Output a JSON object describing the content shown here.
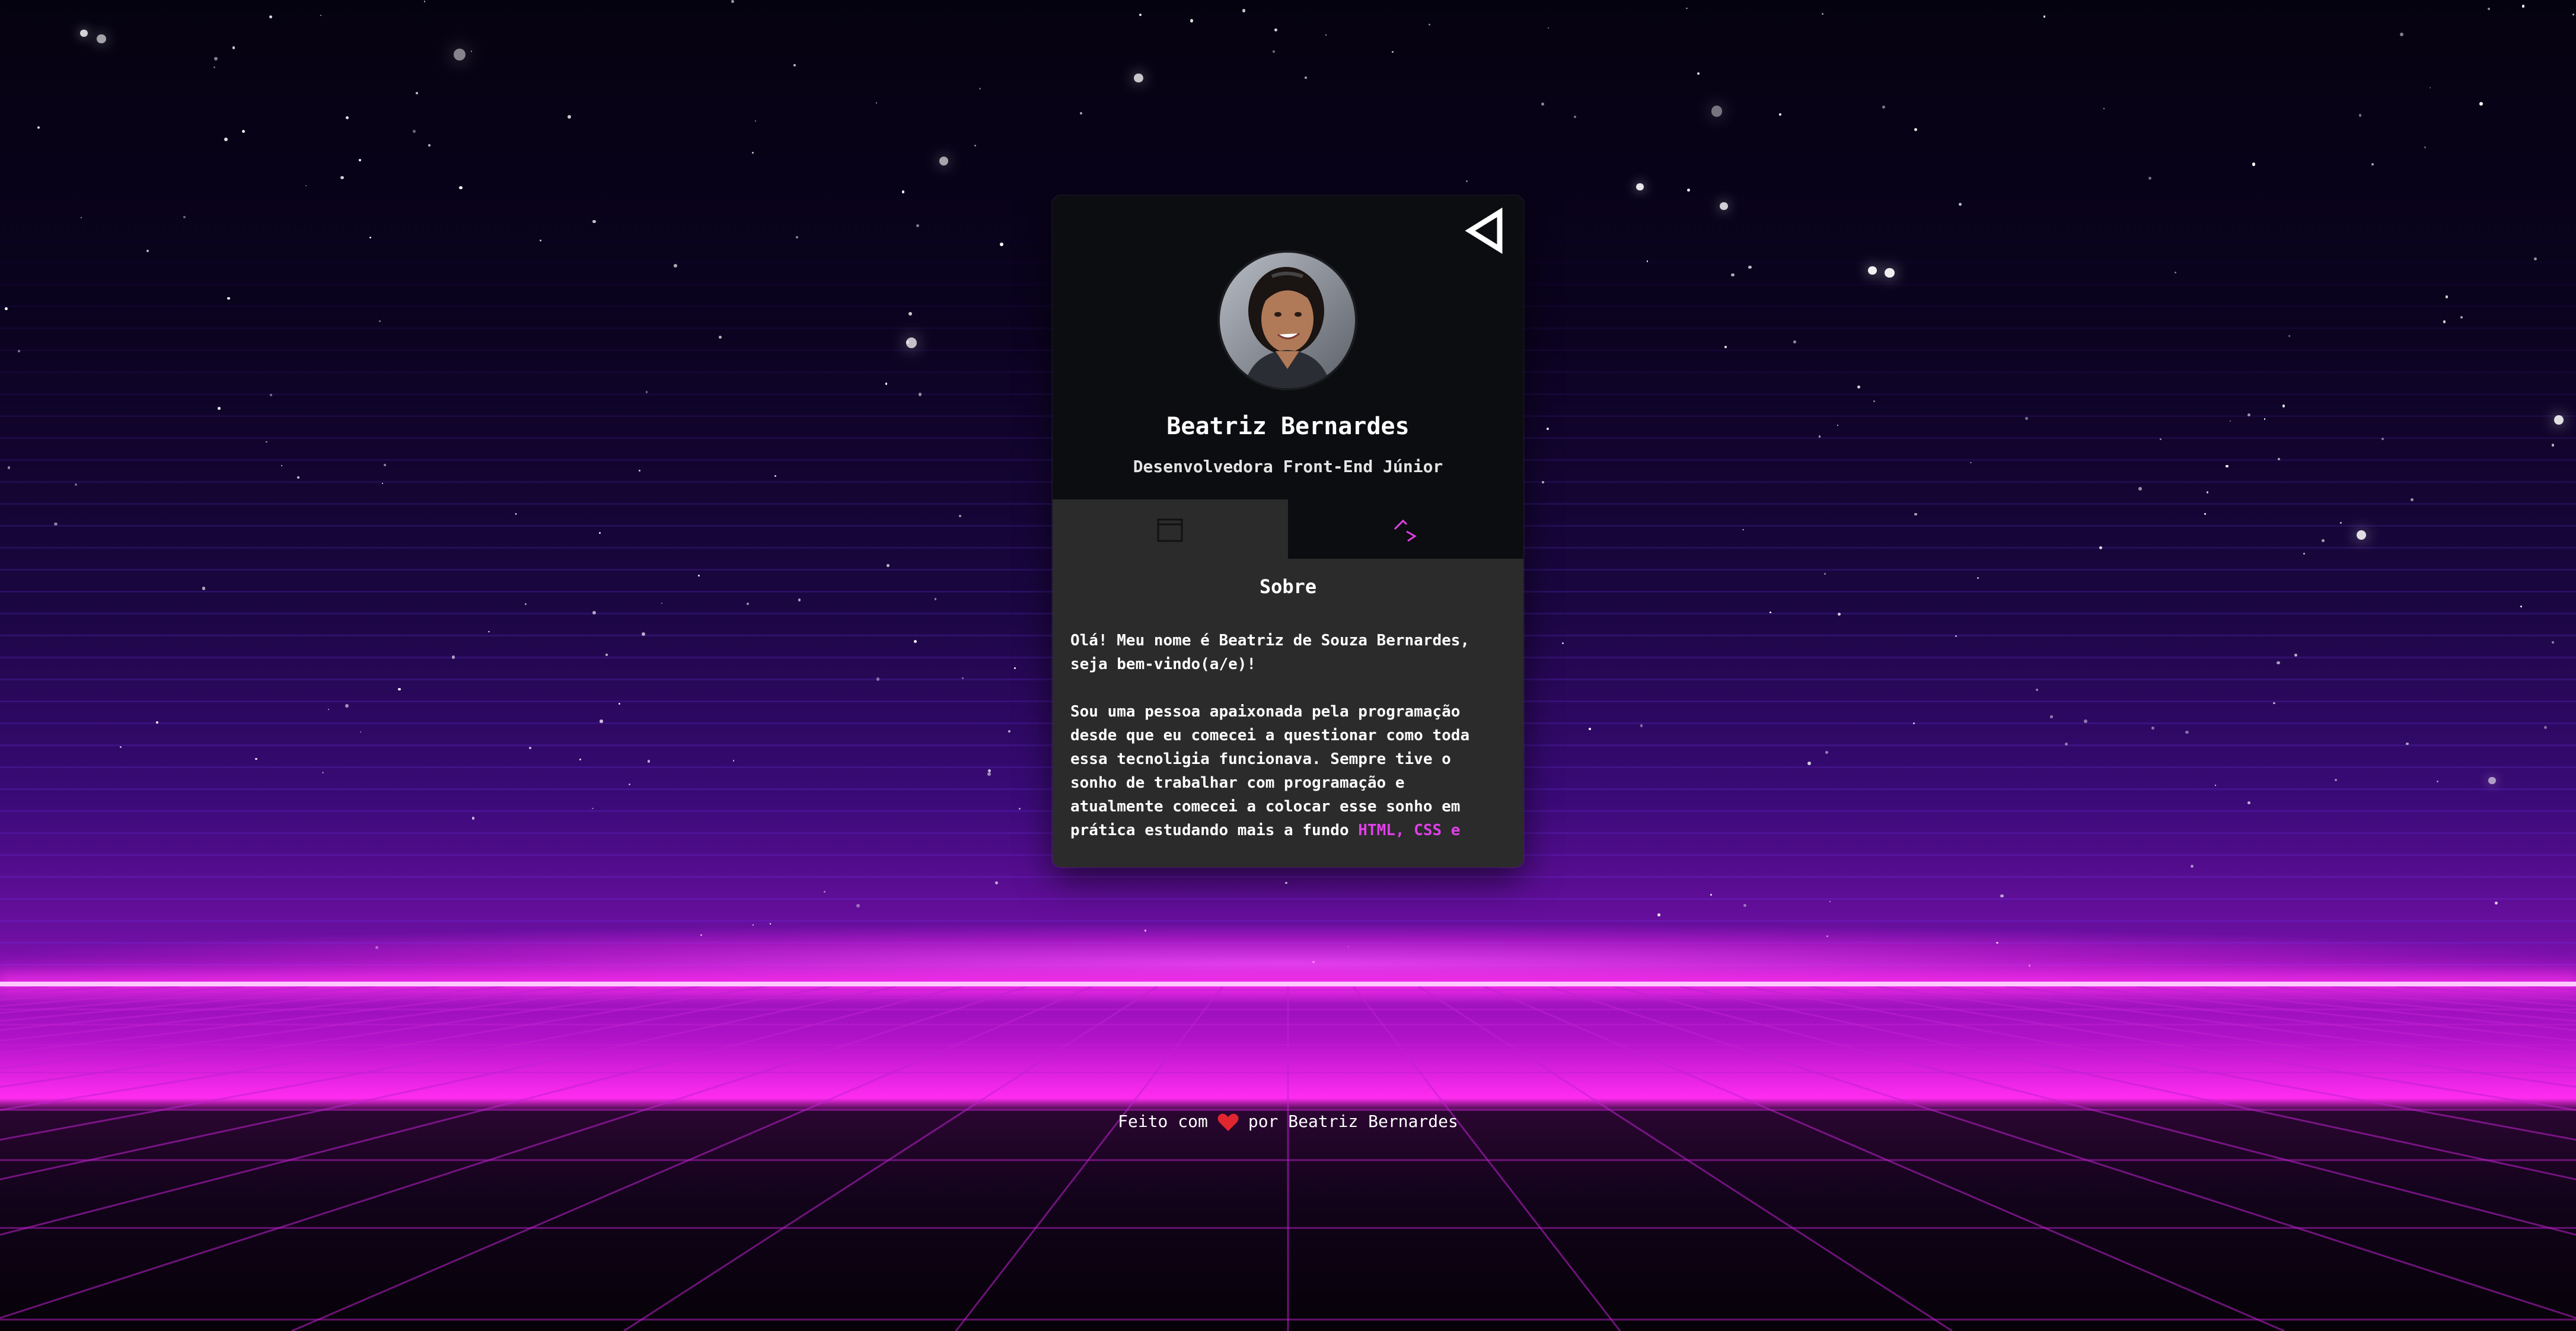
{
  "profile": {
    "name": "Beatriz Bernardes",
    "role": "Desenvolvedora Front-End Júnior",
    "avatar_icon": "profile-photo"
  },
  "header": {
    "share_icon": "share-arrow-icon"
  },
  "tabs": [
    {
      "icon": "window-icon",
      "active": true
    },
    {
      "icon": "code-brackets-icon",
      "active": false
    }
  ],
  "about": {
    "title": "Sobre",
    "line1": "Olá! Meu nome é Beatriz de Souza Bernardes,",
    "line2": "seja bem-vindo(a/e)!",
    "line3": "Sou uma pessoa apaixonada pela programação",
    "line4": "desde que eu comecei a questionar como toda",
    "line5": "essa tecnoligia funcionava. Sempre tive o",
    "line6": "sonho de trabalhar com programação e",
    "line7": "atualmente comecei a colocar esse sonho em",
    "line8_start": "prática estudando mais a fundo ",
    "line8_highlight": "HTML, CSS e"
  },
  "footer": {
    "prefix": "Feito com",
    "suffix": "por Beatriz Bernardes",
    "heart_icon": "heart-icon"
  },
  "colors": {
    "accent": "#e040e8",
    "card_top": "#0c0d10",
    "card_body": "#2b2b2b",
    "horizon": "#ff30f0"
  }
}
